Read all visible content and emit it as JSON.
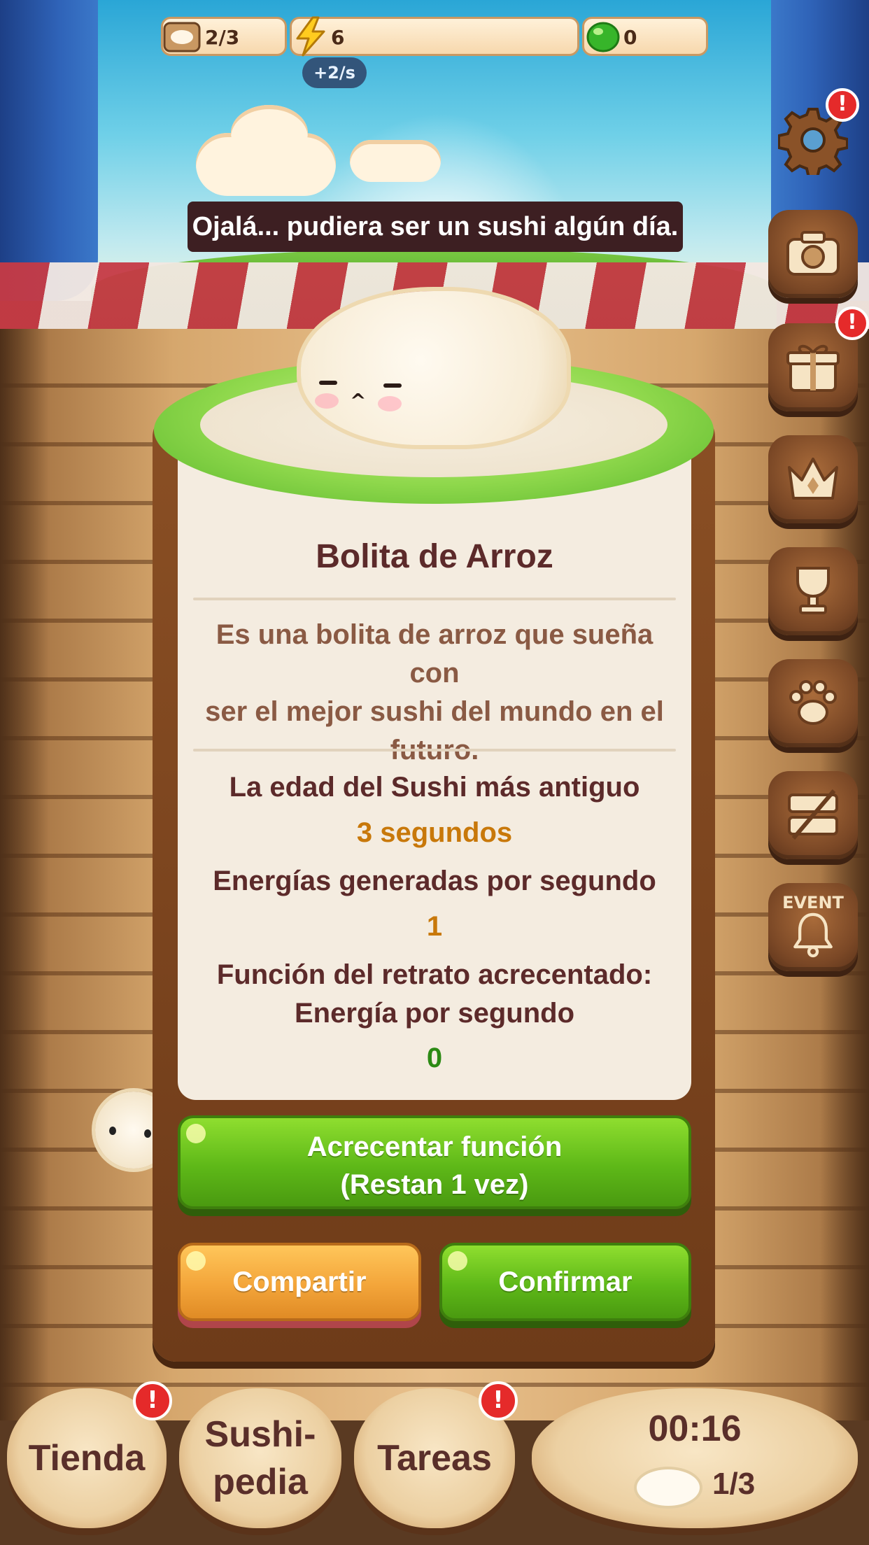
{
  "resources": {
    "capacity": "2/3",
    "energy": "6",
    "gems": "0",
    "energy_rate": "+2/s"
  },
  "speech": "Ojalá... pudiera ser un sushi algún día.",
  "side_menu": [
    {
      "name": "settings",
      "icon": "gear-icon",
      "alert": true
    },
    {
      "name": "camera",
      "icon": "camera-icon",
      "alert": false
    },
    {
      "name": "gift",
      "icon": "gift-icon",
      "alert": true
    },
    {
      "name": "ranking",
      "icon": "crown-icon",
      "alert": false
    },
    {
      "name": "achievements",
      "icon": "trophy-icon",
      "alert": false
    },
    {
      "name": "pets",
      "icon": "paw-icon",
      "alert": false
    },
    {
      "name": "no-ads",
      "icon": "no-ads-icon",
      "alert": false
    },
    {
      "name": "event",
      "icon": "bell-icon",
      "label": "EVENT",
      "alert": false
    }
  ],
  "alert_mark": "!",
  "card": {
    "title": "Bolita de Arroz",
    "description_lines": [
      "Es una bolita de arroz que sueña con",
      "ser el mejor sushi del mundo en el",
      "futuro."
    ],
    "stats": {
      "age_label": "La edad del Sushi más antiguo",
      "age_value": "3 segundos",
      "energy_label": "Energías generadas por segundo",
      "energy_value": "1",
      "portrait_label_1": "Función del retrato acrecentado:",
      "portrait_label_2": "Energía por segundo",
      "portrait_value": "0"
    },
    "upgrade_button": {
      "line1": "Acrecentar función",
      "line2": "(Restan 1 vez)"
    },
    "share_button": "Compartir",
    "confirm_button": "Confirmar"
  },
  "bottom_nav": {
    "shop": "Tienda",
    "sushipedia_1": "Sushi-",
    "sushipedia_2": "pedia",
    "tasks": "Tareas",
    "timer": "00:16",
    "spawn_count": "1/3"
  },
  "colors": {
    "age_value": "#c8780a",
    "energy_value": "#c8780a",
    "portrait_value": "#2c8a14",
    "alert": "#e52a2a",
    "accent_green": "#5eb818",
    "accent_orange": "#f3a53a"
  }
}
